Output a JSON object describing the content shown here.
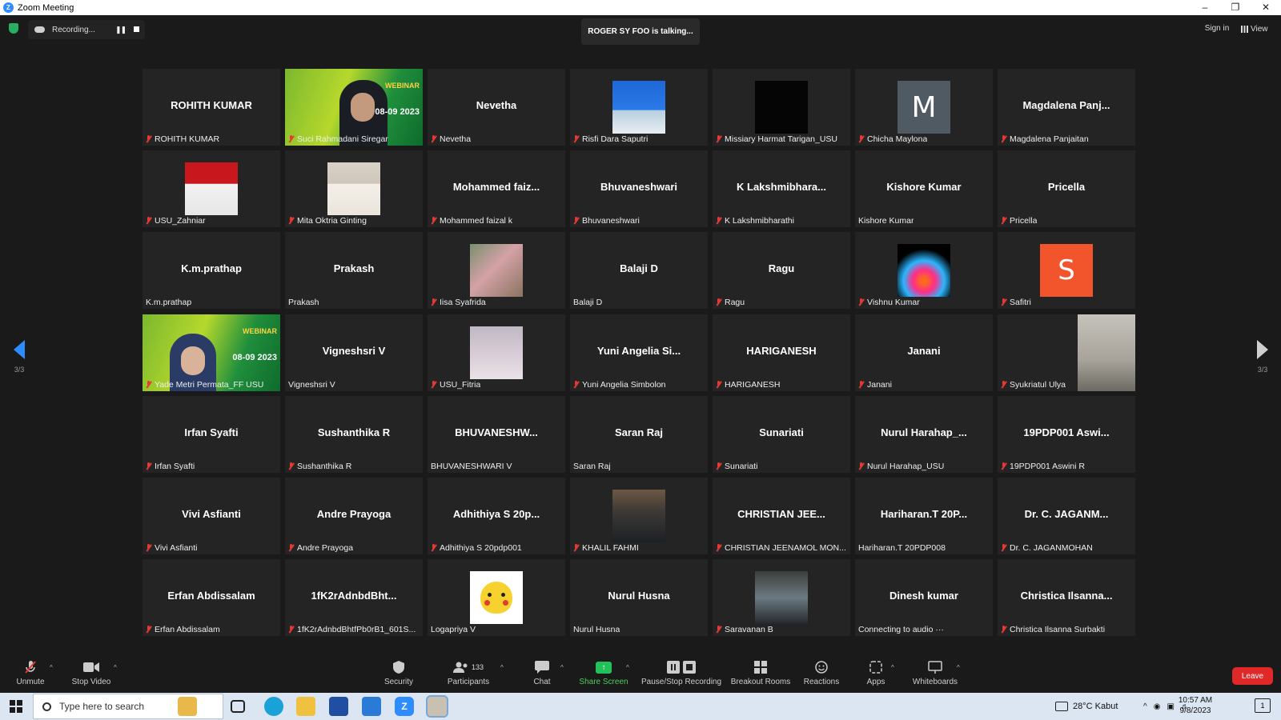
{
  "window": {
    "title": "Zoom Meeting",
    "controls": [
      "–",
      "❐",
      "✕"
    ]
  },
  "top": {
    "recording_label": "Recording...",
    "talking": "ROGER SY FOO is talking...",
    "sign_in": "Sign in",
    "view": "View"
  },
  "nav": {
    "page_left": "3/3",
    "page_right": "3/3"
  },
  "tiles": [
    {
      "big": "ROHITH KUMAR",
      "label": "ROHITH KUMAR",
      "muted": true,
      "thumb": ""
    },
    {
      "big": "",
      "label": "Suci Rahmadani Siregar",
      "muted": true,
      "thumb": "webinar"
    },
    {
      "big": "Nevetha",
      "label": "Nevetha",
      "muted": true,
      "thumb": ""
    },
    {
      "big": "",
      "label": "Risfi Dara Saputri",
      "muted": true,
      "thumb": "thumb-blue"
    },
    {
      "big": "",
      "label": "Missiary Harmat Tarigan_USU",
      "muted": true,
      "thumb": "thumb-black"
    },
    {
      "big": "",
      "label": "Chicha Maylona",
      "muted": true,
      "thumb": "thumb-m",
      "initial": "M"
    },
    {
      "big": "Magdalena  Panj...",
      "label": "Magdalena Panjaitan",
      "muted": true,
      "thumb": ""
    },
    {
      "big": "",
      "label": "USU_Zahniar",
      "muted": true,
      "thumb": "thumb-red"
    },
    {
      "big": "",
      "label": "Mita Oktria Ginting",
      "muted": true,
      "thumb": "thumb-hijab"
    },
    {
      "big": "Mohammed  faiz...",
      "label": "Mohammed faizal k",
      "muted": true,
      "thumb": ""
    },
    {
      "big": "Bhuvaneshwari",
      "label": "Bhuvaneshwari",
      "muted": true,
      "thumb": ""
    },
    {
      "big": "K  Lakshmibhara...",
      "label": "K Lakshmibharathi",
      "muted": true,
      "thumb": ""
    },
    {
      "big": "Kishore Kumar",
      "label": "Kishore Kumar",
      "muted": false,
      "thumb": ""
    },
    {
      "big": "Pricella",
      "label": "Pricella",
      "muted": true,
      "thumb": ""
    },
    {
      "big": "K.m.prathap",
      "label": "K.m.prathap",
      "muted": false,
      "thumb": ""
    },
    {
      "big": "Prakash",
      "label": "Prakash",
      "muted": false,
      "thumb": ""
    },
    {
      "big": "",
      "label": "Iisa Syafrida",
      "muted": true,
      "thumb": "thumb-outdoor"
    },
    {
      "big": "Balaji D",
      "label": "Balaji D",
      "muted": false,
      "thumb": ""
    },
    {
      "big": "Ragu",
      "label": "Ragu",
      "muted": true,
      "thumb": ""
    },
    {
      "big": "",
      "label": "Vishnu Kumar",
      "muted": true,
      "thumb": "thumb-spark"
    },
    {
      "big": "",
      "label": "Safitri",
      "muted": true,
      "thumb": "thumb-s",
      "initial": "S"
    },
    {
      "big": "",
      "label": "Yade Metri Permata_FF USU",
      "muted": true,
      "thumb": "webinar2"
    },
    {
      "big": "Vigneshsri V",
      "label": "Vigneshsri V",
      "muted": false,
      "thumb": ""
    },
    {
      "big": "",
      "label": "USU_Fitria",
      "muted": true,
      "thumb": "thumb-fitria"
    },
    {
      "big": "Yuni  Angelia  Si...",
      "label": "Yuni Angelia Simbolon",
      "muted": true,
      "thumb": ""
    },
    {
      "big": "HARIGANESH",
      "label": "HARIGANESH",
      "muted": true,
      "thumb": ""
    },
    {
      "big": "Janani",
      "label": "Janani",
      "muted": true,
      "thumb": ""
    },
    {
      "big": "",
      "label": "Syukriatul Ulya",
      "muted": true,
      "thumb": "wall"
    },
    {
      "big": "Irfan Syafti",
      "label": "Irfan Syafti",
      "muted": true,
      "thumb": ""
    },
    {
      "big": "Sushanthika R",
      "label": "Sushanthika R",
      "muted": true,
      "thumb": ""
    },
    {
      "big": "BHUVANESHW...",
      "label": "BHUVANESHWARI  V",
      "muted": false,
      "thumb": ""
    },
    {
      "big": "Saran Raj",
      "label": "Saran Raj",
      "muted": false,
      "thumb": ""
    },
    {
      "big": "Sunariati",
      "label": "Sunariati",
      "muted": true,
      "thumb": ""
    },
    {
      "big": "Nurul  Harahap_...",
      "label": "Nurul Harahap_USU",
      "muted": true,
      "thumb": ""
    },
    {
      "big": "19PDP001  Aswi...",
      "label": "19PDP001 Aswini R",
      "muted": true,
      "thumb": ""
    },
    {
      "big": "Vivi Asfianti",
      "label": "Vivi Asfianti",
      "muted": true,
      "thumb": ""
    },
    {
      "big": "Andre Prayoga",
      "label": "Andre Prayoga",
      "muted": true,
      "thumb": ""
    },
    {
      "big": "Adhithiya  S  20p...",
      "label": "Adhithiya S 20pdp001",
      "muted": true,
      "thumb": ""
    },
    {
      "big": "",
      "label": "KHALIL FAHMI",
      "muted": true,
      "thumb": "thumb-man"
    },
    {
      "big": "CHRISTIAN  JEE...",
      "label": "CHRISTIAN JEENAMOL MON...",
      "muted": true,
      "thumb": ""
    },
    {
      "big": "Hariharan.T  20P...",
      "label": "Hariharan.T 20PDP008",
      "muted": false,
      "thumb": ""
    },
    {
      "big": "Dr.  C.  JAGANM...",
      "label": "Dr. C. JAGANMOHAN",
      "muted": true,
      "thumb": ""
    },
    {
      "big": "Erfan Abdissalam",
      "label": "Erfan Abdissalam",
      "muted": true,
      "thumb": ""
    },
    {
      "big": "1fK2rAdnbdBht...",
      "label": "1fK2rAdnbdBhtfPb0rB1_601S...",
      "muted": true,
      "thumb": ""
    },
    {
      "big": "",
      "label": "Logapriya V",
      "muted": false,
      "thumb": "thumb-pika"
    },
    {
      "big": "Nurul Husna",
      "label": "Nurul Husna",
      "muted": false,
      "thumb": ""
    },
    {
      "big": "",
      "label": "Saravanan B",
      "muted": true,
      "thumb": "thumb-street"
    },
    {
      "big": "Dinesh kumar",
      "label": "Connecting to audio ···",
      "muted": false,
      "thumb": ""
    },
    {
      "big": "Christica  Ilsanna...",
      "label": "Christica Ilsanna Surbakti",
      "muted": true,
      "thumb": ""
    }
  ],
  "webinar": {
    "text": "WEBINAR",
    "year": "08-09 2023"
  },
  "toolbar": {
    "unmute": "Unmute",
    "stop_video": "Stop Video",
    "security": "Security",
    "participants": "Participants",
    "participants_count": "133",
    "chat": "Chat",
    "share_screen": "Share Screen",
    "pause_stop_recording": "Pause/Stop Recording",
    "breakout_rooms": "Breakout Rooms",
    "reactions": "Reactions",
    "apps": "Apps",
    "whiteboards": "Whiteboards",
    "leave": "Leave"
  },
  "taskbar": {
    "search_placeholder": "Type here to search",
    "weather": "28°C  Kabut",
    "time": "10:57 AM",
    "date": "9/8/2023",
    "notifications": "1"
  }
}
